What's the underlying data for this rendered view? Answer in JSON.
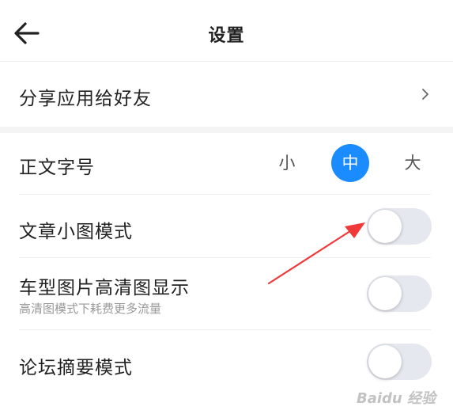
{
  "header": {
    "back_icon": "arrow-left-icon",
    "title": "设置"
  },
  "share": {
    "label": "分享应用给好友",
    "chevron_icon": "chevron-right-icon"
  },
  "font_size": {
    "label": "正文字号",
    "options": [
      {
        "label": "小",
        "selected": false
      },
      {
        "label": "中",
        "selected": true
      },
      {
        "label": "大",
        "selected": false
      }
    ],
    "accent_color": "#1a8cff"
  },
  "toggles": [
    {
      "label": "文章小图模式",
      "sub": "",
      "on": false
    },
    {
      "label": "车型图片高清图显示",
      "sub": "高清图模式下耗费更多流量",
      "on": false
    },
    {
      "label": "论坛摘要模式",
      "sub": "",
      "on": false
    }
  ],
  "annotation": {
    "arrow_color": "#f03a3a"
  },
  "watermark": {
    "text": "Baidu 经验"
  }
}
